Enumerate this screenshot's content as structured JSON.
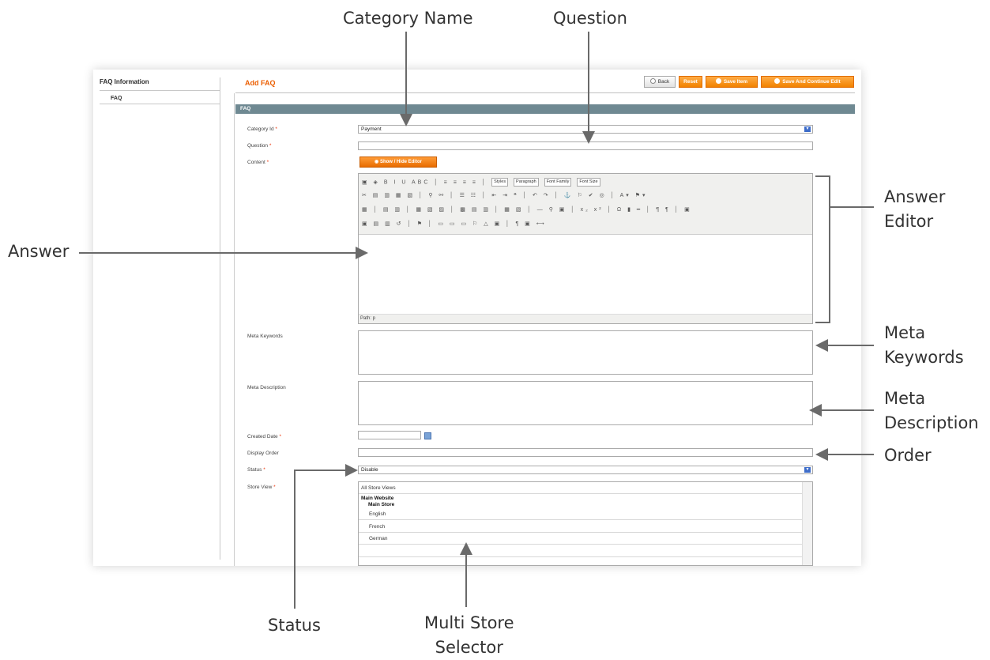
{
  "callouts": {
    "category_name": "Category Name",
    "question": "Question",
    "answer_editor_line1": "Answer",
    "answer_editor_line2": "Editor",
    "answer": "Answer",
    "meta_keywords_line1": "Meta",
    "meta_keywords_line2": "Keywords",
    "meta_description_line1": "Meta",
    "meta_description_line2": "Description",
    "order": "Order",
    "status": "Status",
    "multi_store_line1": "Multi Store",
    "multi_store_line2": "Selector"
  },
  "sidebar": {
    "title": "FAQ Information",
    "tab_label": "FAQ"
  },
  "header": {
    "page_title": "Add FAQ",
    "back_label": "Back",
    "reset_label": "Reset",
    "save_item_label": "Save Item",
    "save_continue_label": "Save And Continue Edit"
  },
  "section": {
    "title": "FAQ"
  },
  "form": {
    "category_label": "Category Id",
    "category_value": "Payment",
    "question_label": "Question",
    "question_value": "",
    "content_label": "Content",
    "show_hide_label": "Show / Hide Editor",
    "meta_keywords_label": "Meta Keywords",
    "meta_description_label": "Meta Description",
    "created_date_label": "Created Date",
    "display_order_label": "Display Order",
    "status_label": "Status",
    "status_value": "Disable",
    "store_view_label": "Store View",
    "required_mark": "*"
  },
  "editor": {
    "styles_select": "Styles",
    "paragraph_select": "Paragraph",
    "font_family_select": "Font Family",
    "font_size_select": "Font Size",
    "path_text": "Path: p"
  },
  "store_views": {
    "all": "All Store Views",
    "website": "Main Website",
    "store": "Main Store",
    "views": [
      "English",
      "French",
      "German"
    ]
  },
  "colors": {
    "accent_orange": "#eb5e00",
    "section_bar": "#6f8992",
    "annotation_line": "#7a7a7a"
  }
}
